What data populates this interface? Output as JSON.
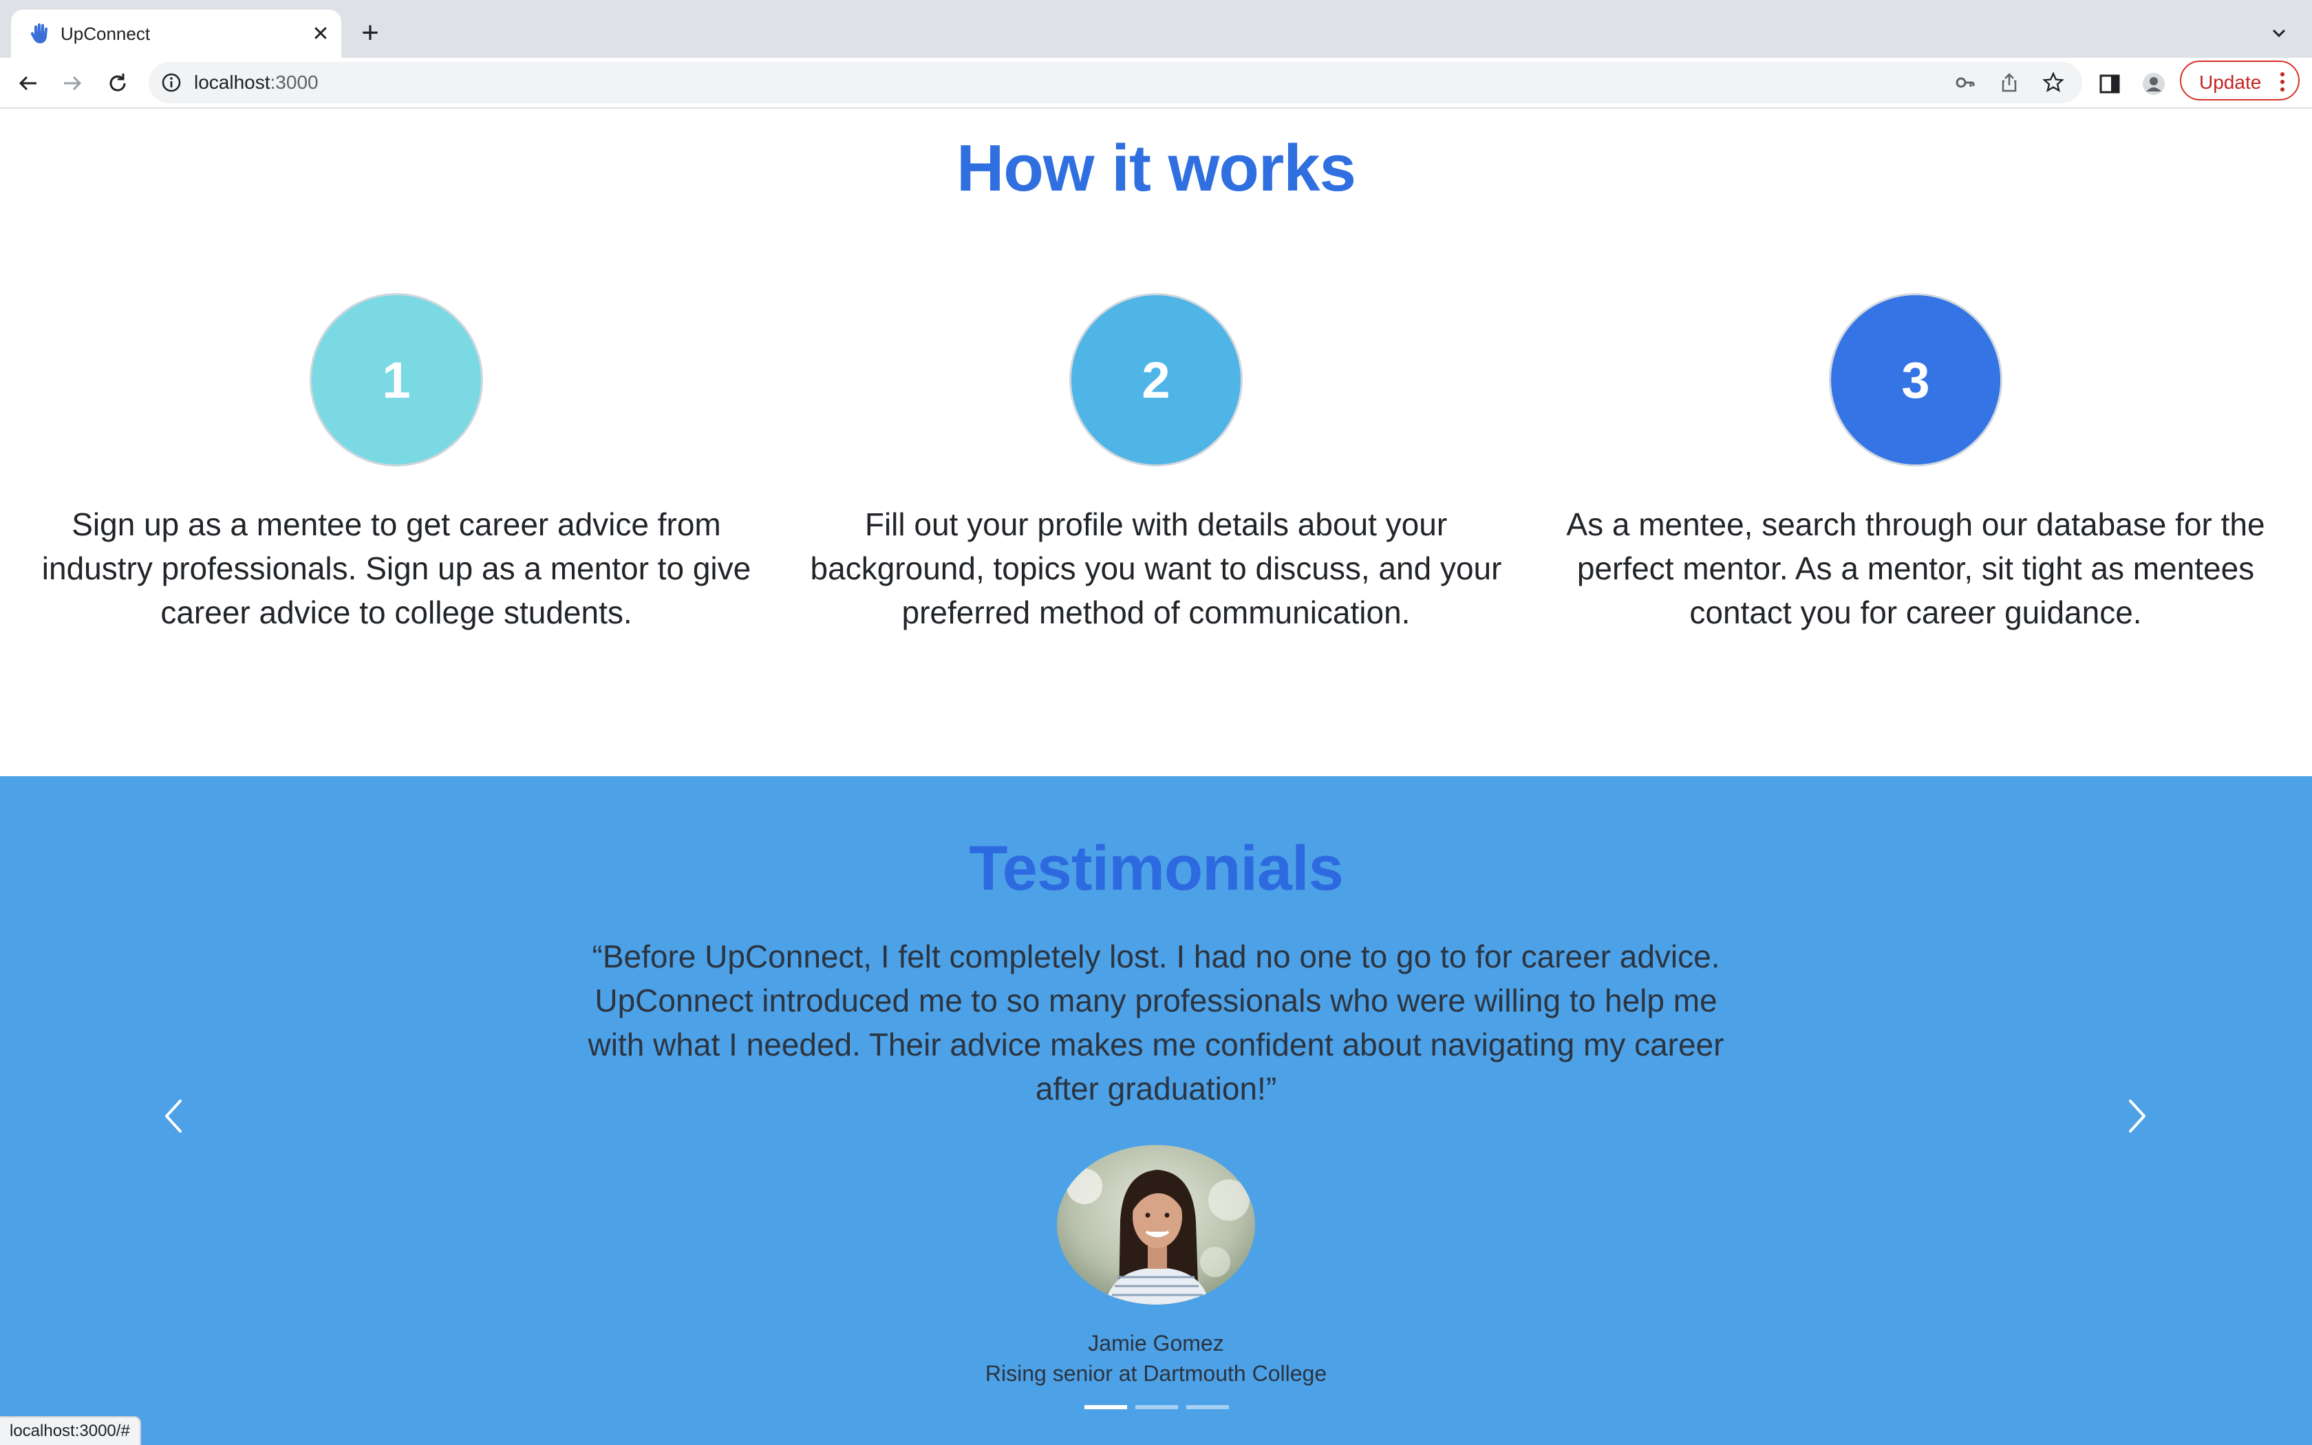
{
  "browser": {
    "tab_title": "UpConnect",
    "url_host": "localhost",
    "url_port": ":3000",
    "update_label": "Update",
    "status_url": "localhost:3000/#"
  },
  "how_it_works": {
    "title": "How it works",
    "steps": [
      {
        "number": "1",
        "color": "#7bd9e4",
        "text": "Sign up as a mentee to get career advice from industry professionals. Sign up as a mentor to give career advice to college students."
      },
      {
        "number": "2",
        "color": "#4fb4e6",
        "text": "Fill out your profile with details about your background, topics you want to discuss, and your preferred method of communication."
      },
      {
        "number": "3",
        "color": "#3474e4",
        "text": "As a mentee, search through our database for the perfect mentor. As a mentor, sit tight as mentees contact you for career guidance."
      }
    ]
  },
  "testimonials": {
    "title": "Testimonials",
    "quote": "“Before UpConnect, I felt completely lost. I had no one to go to for career advice. UpConnect introduced me to so many professionals who were willing to help me with what I needed. Their advice makes me confident about navigating my career after graduation!”",
    "name": "Jamie Gomez",
    "role": "Rising senior at Dartmouth College",
    "slide_count": 3,
    "active_slide": 1
  },
  "colors": {
    "brand_blue": "#2f6fe0",
    "testimonial_bg": "#4da1e7"
  }
}
